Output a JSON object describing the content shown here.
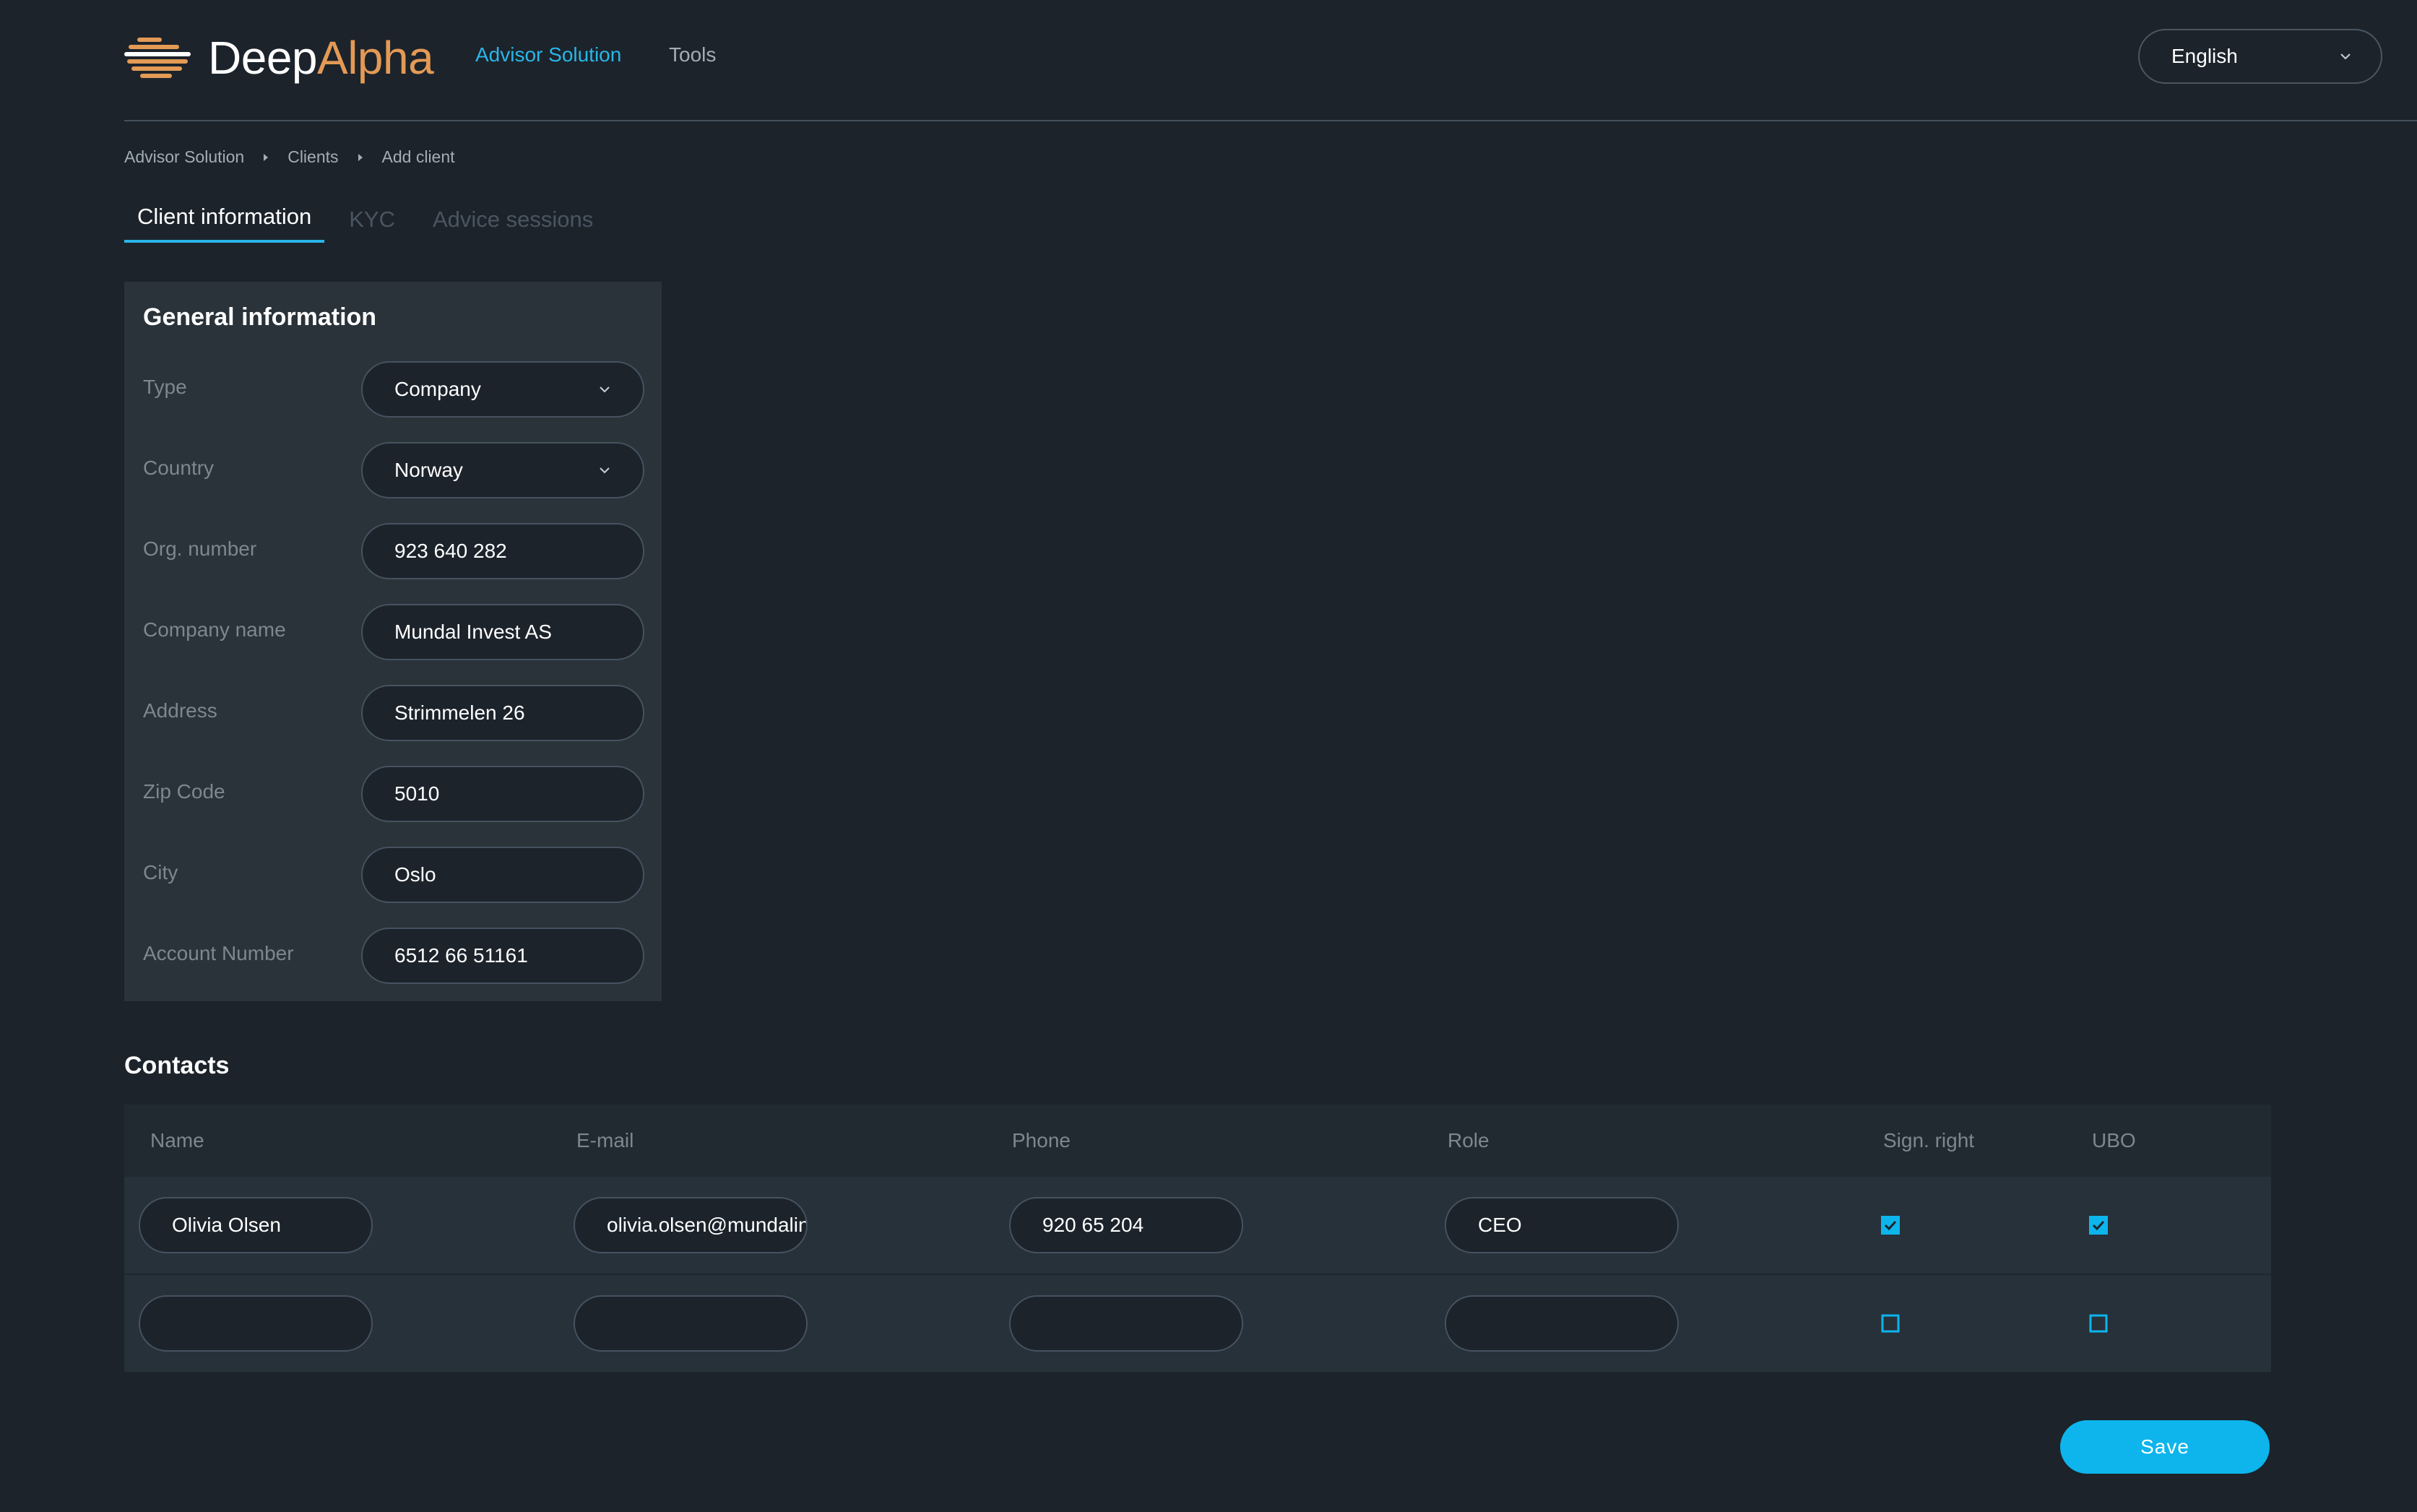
{
  "brand": {
    "part1": "Deep",
    "part2": "Alpha",
    "accent": "#e39a55"
  },
  "nav": {
    "items": [
      "Advisor Solution",
      "Tools"
    ],
    "active_color": "#29b6e8"
  },
  "language": {
    "selected": "English",
    "icon": "chevron-down-icon"
  },
  "breadcrumb": [
    "Advisor Solution",
    "Clients",
    "Add client"
  ],
  "tabs": [
    "Client information",
    "KYC",
    "Advice sessions"
  ],
  "general": {
    "title": "General information",
    "fields": [
      {
        "label": "Type",
        "value": "Company",
        "dropdown": true
      },
      {
        "label": "Country",
        "value": "Norway",
        "dropdown": true
      },
      {
        "label": "Org. number",
        "value": "923 640 282"
      },
      {
        "label": "Company name",
        "value": "Mundal Invest AS"
      },
      {
        "label": "Address",
        "value": "Strimmelen 26"
      },
      {
        "label": "Zip Code",
        "value": "5010"
      },
      {
        "label": "City",
        "value": "Oslo"
      },
      {
        "label": "Account Number",
        "value": "6512 66 51161"
      }
    ]
  },
  "contacts": {
    "title": "Contacts",
    "columns": [
      "Name",
      "E-mail",
      "Phone",
      "Role",
      "Sign. right",
      "UBO"
    ],
    "rows": [
      {
        "name": "Olivia Olsen",
        "email": "olivia.olsen@mundalinvest.no",
        "phone": "920 65 204",
        "role": "CEO",
        "sign_right": true,
        "ubo": true
      },
      {
        "name": "",
        "email": "",
        "phone": "",
        "role": "",
        "sign_right": false,
        "ubo": false
      }
    ]
  },
  "actions": {
    "save": "Save"
  },
  "colors": {
    "background": "#1c232b",
    "panel": "#2a3339",
    "accent": "#0db5ec"
  }
}
